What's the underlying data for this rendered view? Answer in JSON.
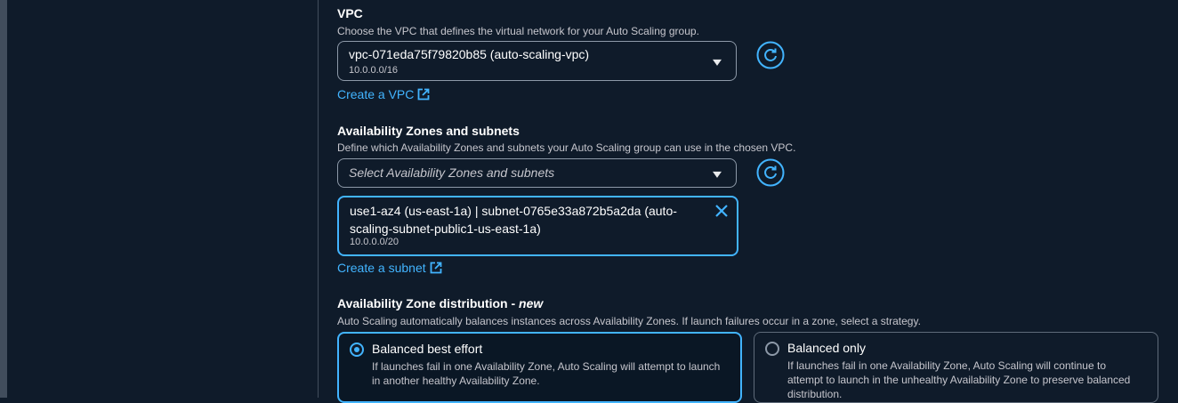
{
  "vpc": {
    "label": "VPC",
    "description": "Choose the VPC that defines the virtual network for your Auto Scaling group.",
    "selected_value": "vpc-071eda75f79820b85 (auto-scaling-vpc)",
    "selected_cidr": "10.0.0.0/16",
    "create_link": "Create a VPC"
  },
  "subnets": {
    "label": "Availability Zones and subnets",
    "description": "Define which Availability Zones and subnets your Auto Scaling group can use in the chosen VPC.",
    "placeholder": "Select Availability Zones and subnets",
    "token_text": "use1-az4 (us-east-1a) | subnet-0765e33a872b5a2da (auto-scaling-subnet-public1-us-east-1a)",
    "token_cidr": "10.0.0.0/20",
    "create_link": "Create a subnet"
  },
  "distribution": {
    "label": "Availability Zone distribution - ",
    "label_new": "new",
    "description": "Auto Scaling automatically balances instances across Availability Zones. If launch failures occur in a zone, select a strategy.",
    "options": [
      {
        "title": "Balanced best effort",
        "desc": "If launches fail in one Availability Zone, Auto Scaling will attempt to launch in another healthy Availability Zone.",
        "selected": true
      },
      {
        "title": "Balanced only",
        "desc": "If launches fail in one Availability Zone, Auto Scaling will continue to attempt to launch in the unhealthy Availability Zone to preserve balanced distribution.",
        "selected": false
      }
    ]
  },
  "colors": {
    "accent": "#42b4ff",
    "background": "#0f1b2a"
  }
}
